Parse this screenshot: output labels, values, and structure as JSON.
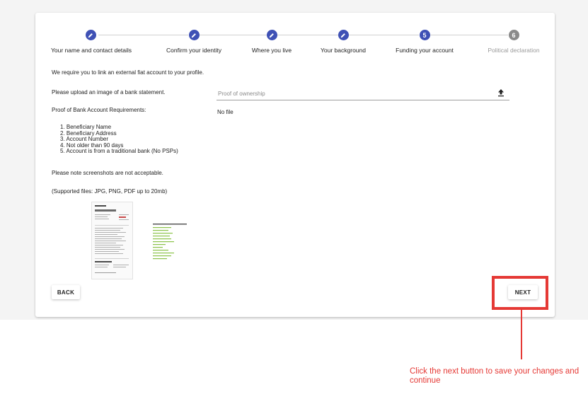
{
  "stepper": {
    "steps": [
      {
        "label": "Your name and contact details",
        "state": "done",
        "icon": "pencil-icon"
      },
      {
        "label": "Confirm your identity",
        "state": "done",
        "icon": "pencil-icon"
      },
      {
        "label": "Where you live",
        "state": "done",
        "icon": "pencil-icon"
      },
      {
        "label": "Your background",
        "state": "done",
        "icon": "pencil-icon"
      },
      {
        "label": "Funding your account",
        "state": "active",
        "number": "5"
      },
      {
        "label": "Political declaration",
        "state": "pending",
        "number": "6"
      }
    ]
  },
  "content": {
    "intro": "We require you to link an external fiat account to your profile.",
    "upload_prompt": "Please upload an image of a bank statement.",
    "requirements_title": "Proof of Bank Account Requirements:",
    "requirements": [
      "1. Beneficiary Name",
      "2. Beneficiary Address",
      "3. Account Number",
      "4. Not older than 90 days",
      "5. Account is from a traditional bank (No PSPs)"
    ],
    "screenshot_note": "Please note screenshots are not acceptable.",
    "supported_files": "(Supported files: JPG, PNG, PDF up to 20mb)"
  },
  "upload": {
    "field_label": "Proof of ownership",
    "status": "No file",
    "icon": "upload-icon"
  },
  "buttons": {
    "back": "BACK",
    "next": "NEXT"
  },
  "annotation": {
    "text": "Click the next button to save your changes and continue",
    "color": "#e53935"
  },
  "colors": {
    "accent": "#3f51b5",
    "pending": "#8a8a8a",
    "highlight": "#e53935"
  }
}
